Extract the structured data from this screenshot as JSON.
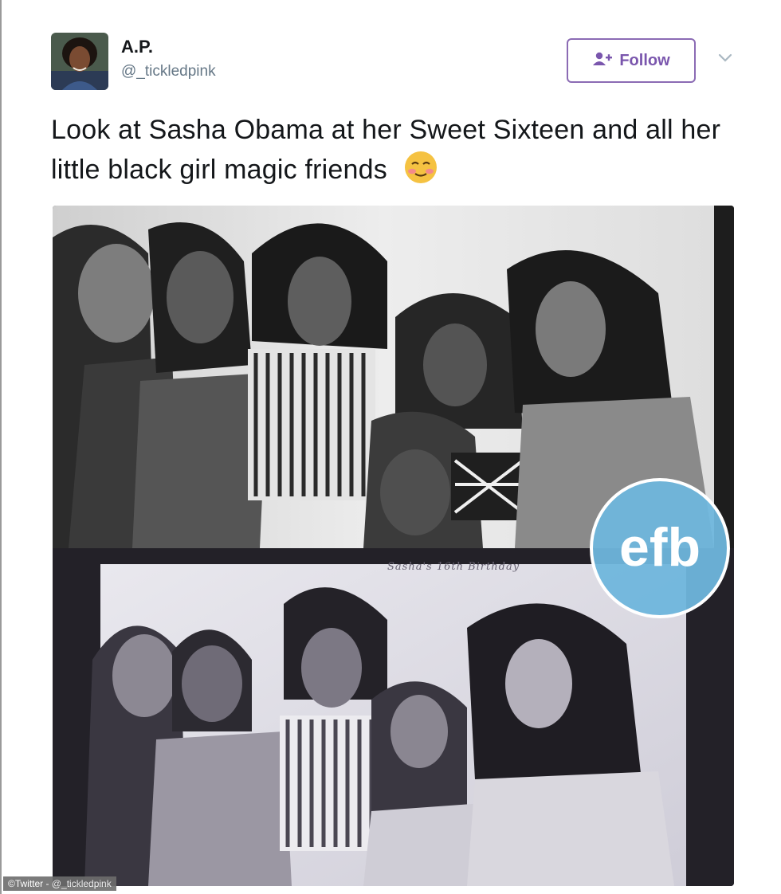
{
  "tweet": {
    "author": {
      "display_name": "A.P.",
      "handle": "@_tickledpink"
    },
    "follow_button": {
      "label": "Follow",
      "icon": "add-user-icon",
      "accent_color": "#7a56ad"
    },
    "menu_icon": "chevron-down-icon",
    "text": "Look at Sasha Obama at her Sweet Sixteen and all her little black girl magic friends",
    "emoji": "smiling-face-with-blush-emoji",
    "media": {
      "booth_caption": "Sasha's 16th Birthday",
      "watermark_logo": "efb",
      "watermark_color": "#6fb6dc",
      "credit": "©Twitter - @_tickledpink"
    }
  }
}
